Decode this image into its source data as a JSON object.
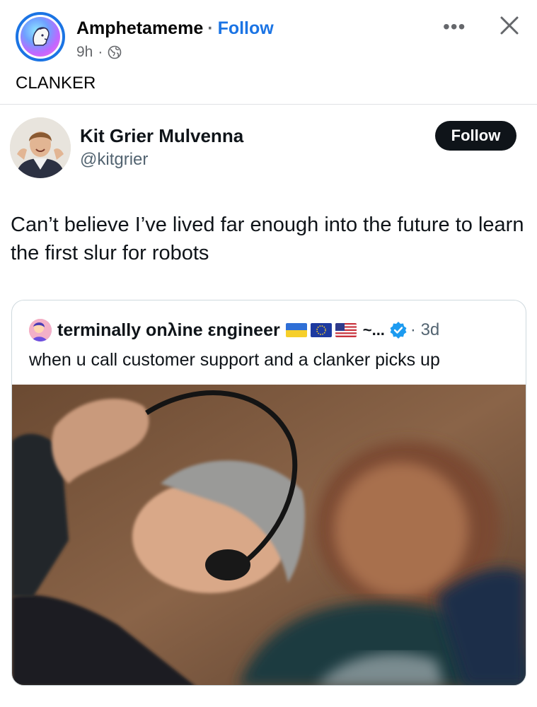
{
  "post": {
    "page_name": "Amphetameme",
    "separator": "·",
    "follow_label": "Follow",
    "time": "9h",
    "time_separator": "·",
    "privacy_icon": "globe-icon",
    "more_icon": "•••",
    "caption": "CLANKER"
  },
  "tweet": {
    "author_name": "Kit Grier Mulvenna",
    "author_handle": "@kitgrier",
    "follow_label": "Follow",
    "text": "Can’t believe I’ve lived far enough into the future to learn the first slur for robots"
  },
  "quoted_tweet": {
    "author_name": "terminally onλine εngineer",
    "flags": [
      "ukraine-flag",
      "eu-flag",
      "us-flag"
    ],
    "suffix": "~...",
    "verified_icon": "verified-badge-icon",
    "time": "· 3d",
    "text": "when u call customer support and a clanker picks up"
  },
  "colors": {
    "facebook_blue": "#1b74e4",
    "secondary_text": "#65676b",
    "twitter_dark": "#0f1419",
    "twitter_gray": "#536471",
    "verified_blue": "#1d9bf0"
  }
}
